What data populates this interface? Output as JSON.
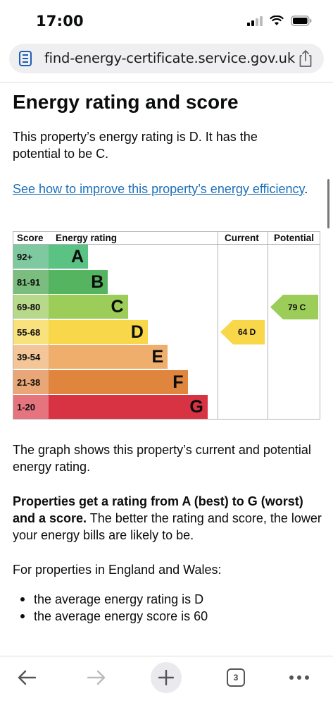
{
  "status_bar": {
    "time": "17:00"
  },
  "browser": {
    "url": "find-energy-certificate.service.gov.uk",
    "tab_count": "3"
  },
  "page": {
    "title": "Energy rating and score",
    "intro": "This property’s energy rating is D. It has the potential to be C.",
    "improve_link": "See how to improve this property’s energy efficiency",
    "improve_link_suffix": ".",
    "graph_caption": "The graph shows this property’s current and potential energy rating.",
    "ratings_bold": "Properties get a rating from A (best) to G (worst) and a score.",
    "ratings_rest": " The better the rating and score, the lower your energy bills are likely to be.",
    "region_intro": "For properties in England and Wales:",
    "averages": [
      "the average energy rating is D",
      "the average energy score is 60"
    ]
  },
  "chart_data": {
    "type": "table",
    "headers": {
      "score": "Score",
      "rating": "Energy rating",
      "current": "Current",
      "potential": "Potential"
    },
    "bands": [
      {
        "score": "92+",
        "letter": "A",
        "color": "#5ac282",
        "score_color": "#7ec9a0"
      },
      {
        "score": "81-91",
        "letter": "B",
        "color": "#54b45f",
        "score_color": "#7bbd7f"
      },
      {
        "score": "69-80",
        "letter": "C",
        "color": "#9ccd58",
        "score_color": "#b8d88a"
      },
      {
        "score": "55-68",
        "letter": "D",
        "color": "#f8d74b",
        "score_color": "#f9e17e"
      },
      {
        "score": "39-54",
        "letter": "E",
        "color": "#f0ae6d",
        "score_color": "#f3c597"
      },
      {
        "score": "21-38",
        "letter": "F",
        "color": "#e0853d",
        "score_color": "#e9a676"
      },
      {
        "score": "1-20",
        "letter": "G",
        "color": "#d83343",
        "score_color": "#e5747f"
      }
    ],
    "current": {
      "score": 64,
      "band": "D",
      "label": "64 D",
      "color": "#f8d74b"
    },
    "potential": {
      "score": 79,
      "band": "C",
      "label": "79 C",
      "color": "#9ccd58"
    }
  }
}
